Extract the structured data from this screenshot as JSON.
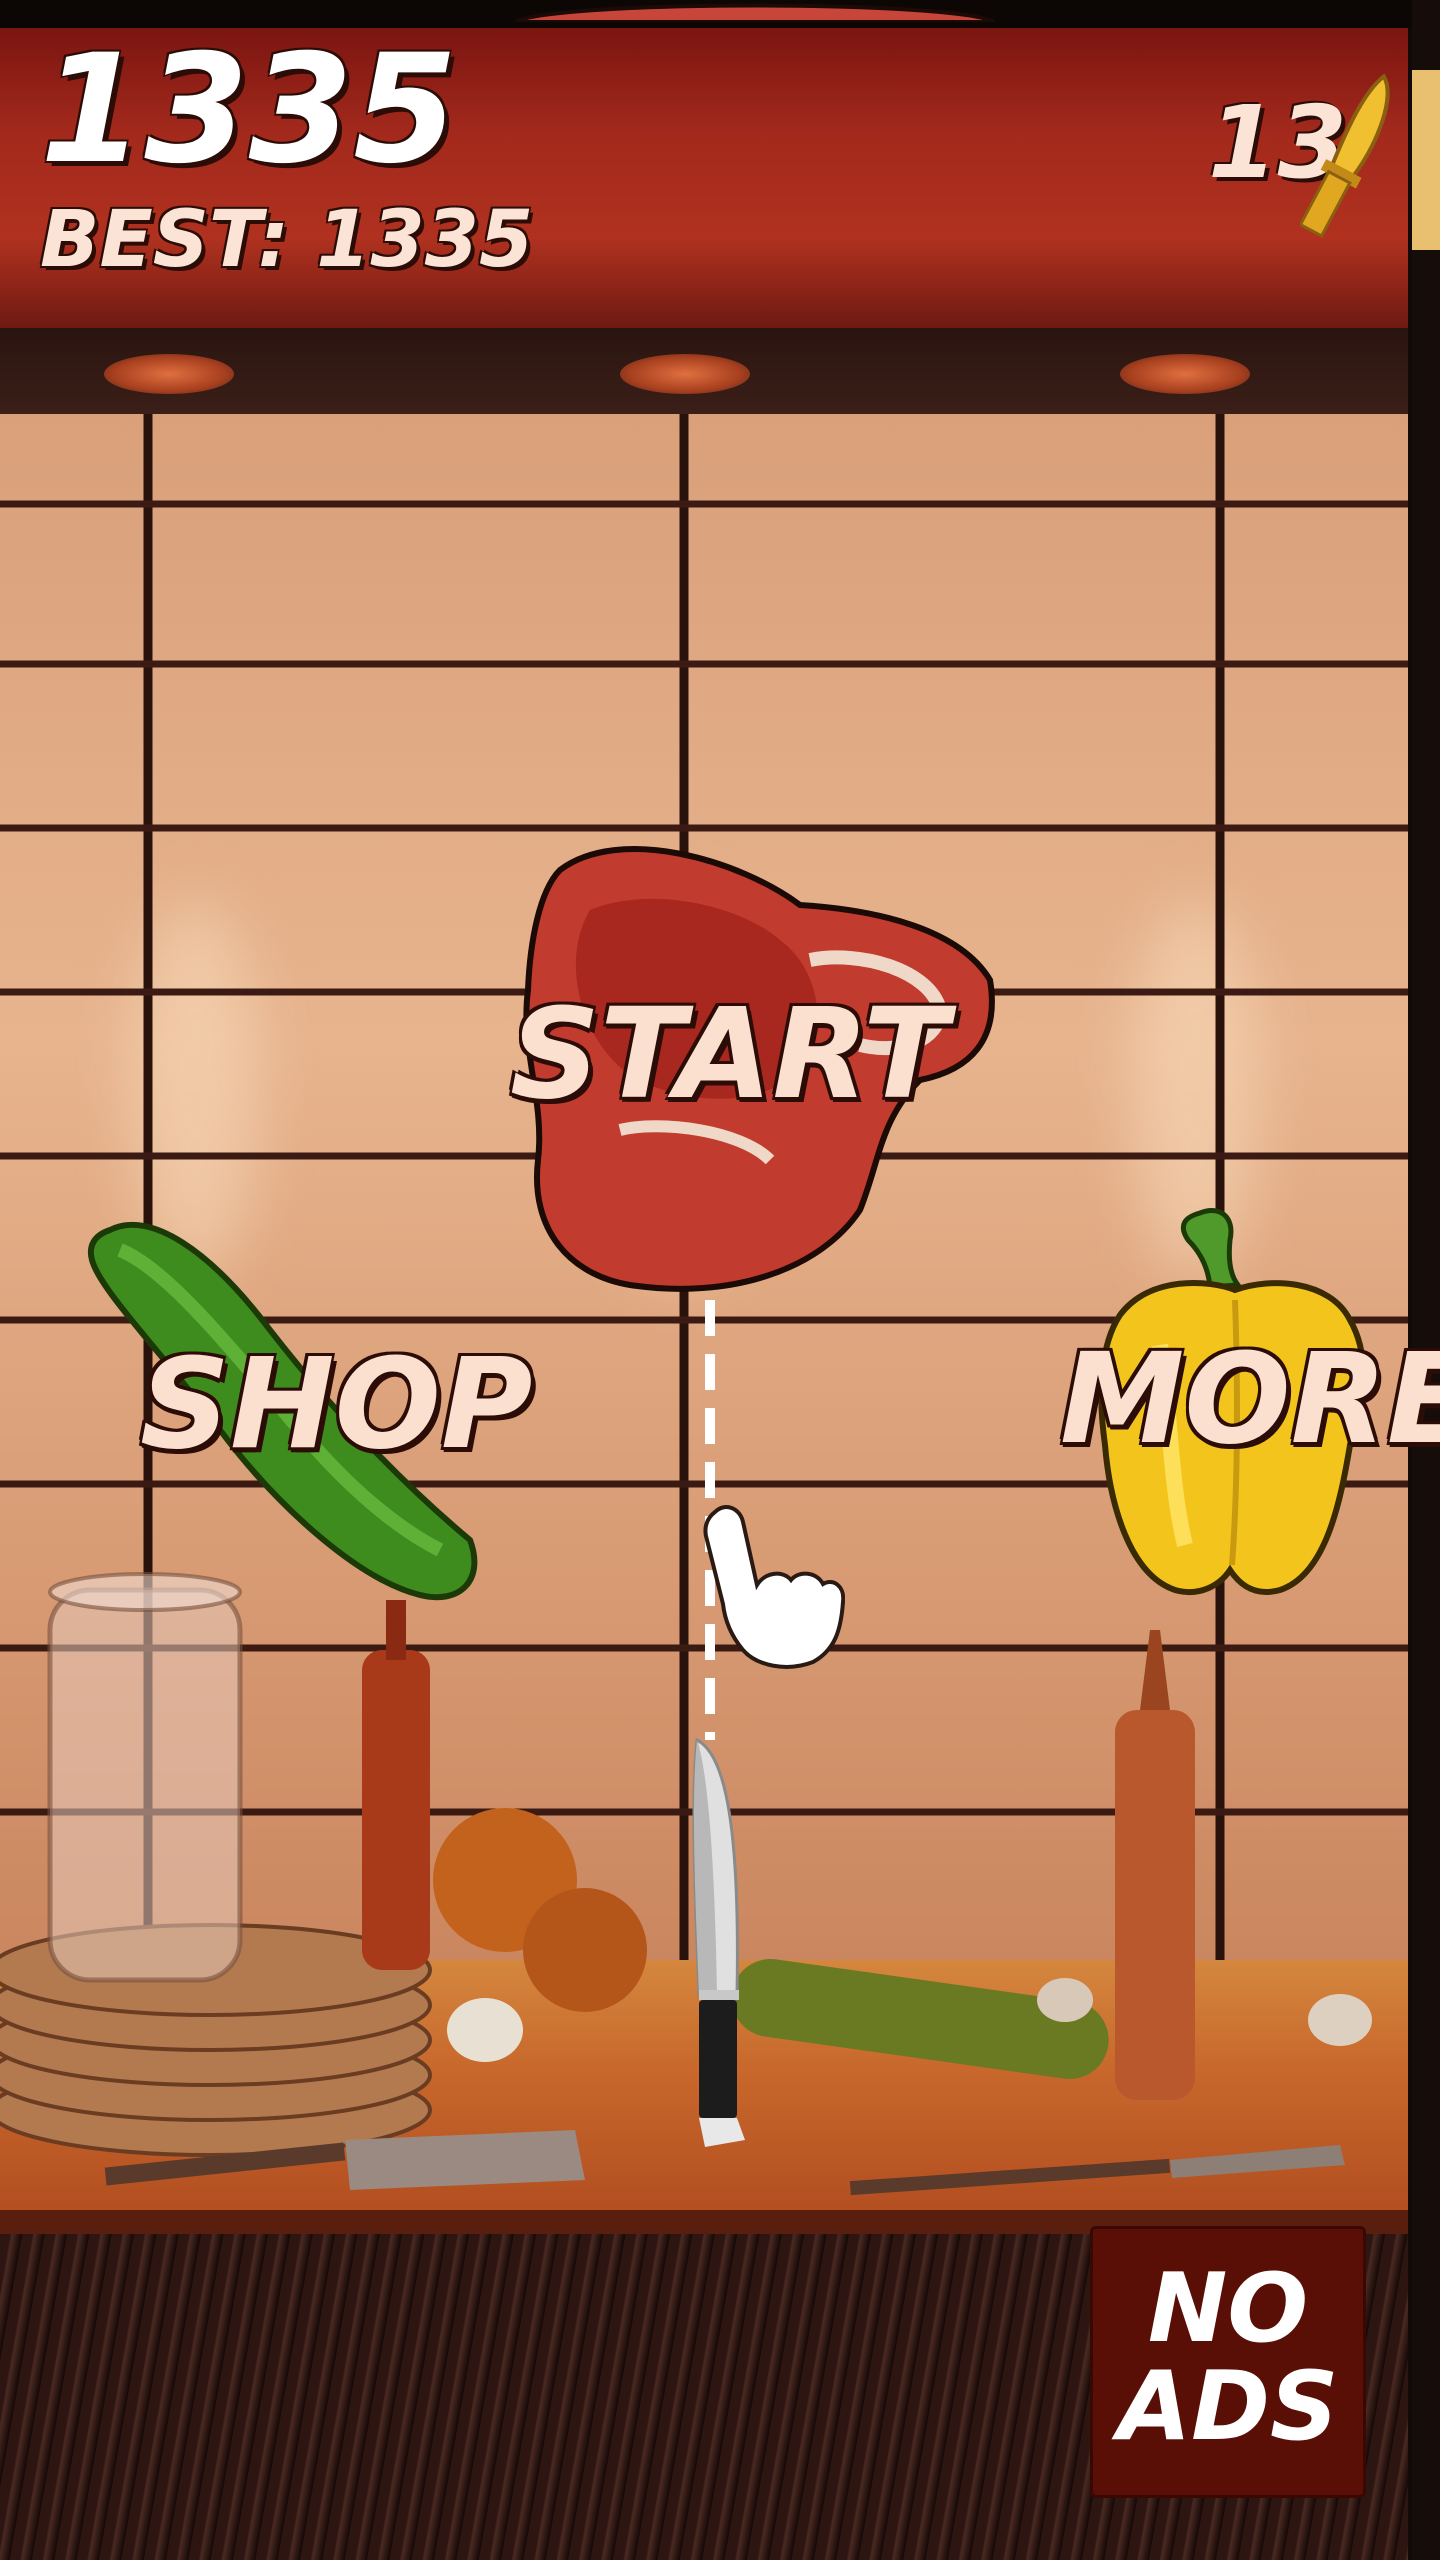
{
  "hud": {
    "score": "1335",
    "best_label": "BEST: 1335",
    "knives_left": "13"
  },
  "menu": {
    "start_label": "START",
    "shop_label": "SHOP",
    "more_label": "MORE"
  },
  "noads": {
    "line1": "NO",
    "line2": "ADS"
  },
  "icons": {
    "knife_counter": "gold-knife-icon",
    "start_target": "steak-icon",
    "shop_target": "cucumber-icon",
    "more_target": "yellow-pepper-icon",
    "tutorial": "pointing-hand-icon",
    "player_knife": "kitchen-knife-icon"
  },
  "colors": {
    "header_red": "#a3291c",
    "label_text": "#fbe0d0",
    "outline": "#2c0c06",
    "noads_bg": "#5a0f06"
  }
}
